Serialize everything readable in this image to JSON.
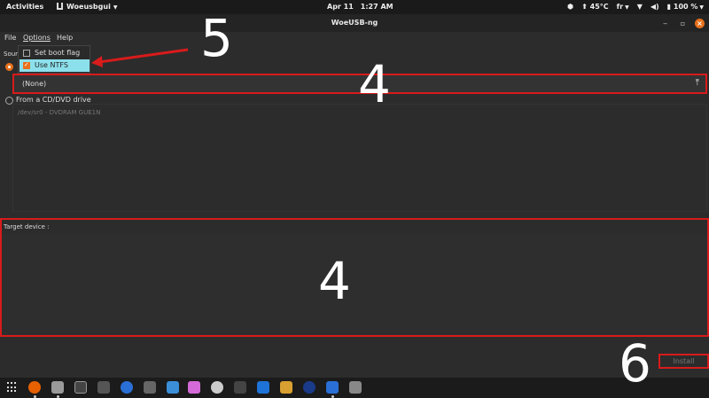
{
  "topbar": {
    "activities": "Activities",
    "app_name": "Woeusbgui",
    "date": "Apr 11",
    "time": "1:27 AM",
    "temperature": "45°C",
    "keyboard_layout": "fr",
    "battery": "100 %"
  },
  "window": {
    "title": "WoeUSB-ng"
  },
  "menubar": {
    "file": "File",
    "options": "Options",
    "help": "Help"
  },
  "options_menu": {
    "items": [
      {
        "label": "Set boot flag",
        "checked": false
      },
      {
        "label": "Use NTFS",
        "checked": true
      }
    ]
  },
  "source": {
    "label": "Sour",
    "file_value": "(None)",
    "cd_option_label": "From a CD/DVD drive",
    "cd_drive": "/dev/sr0 - DVDRAM GUE1N"
  },
  "target": {
    "label": "Target device :"
  },
  "actions": {
    "install": "Install"
  },
  "annotations": {
    "n5": "5",
    "n4_top": "4",
    "n4_bottom": "4",
    "n6": "6"
  },
  "colors": {
    "accent": "#e8701a",
    "highlight": "#8ce0ec",
    "annotation": "#d81b1b"
  }
}
